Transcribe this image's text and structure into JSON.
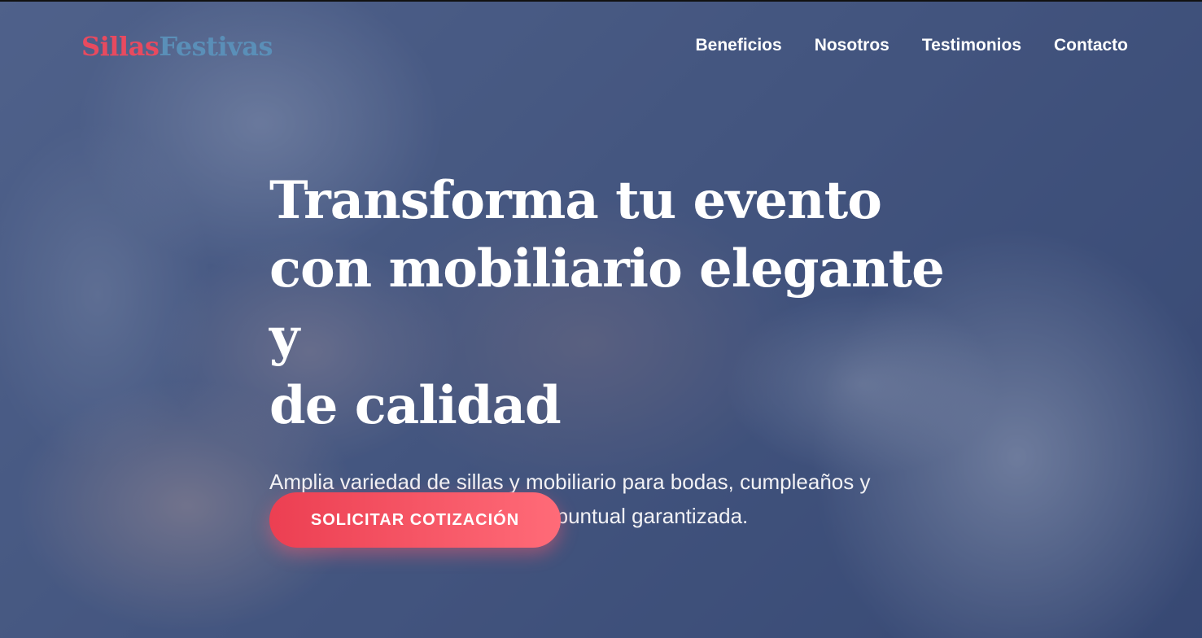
{
  "brand": {
    "part1": "Sillas",
    "part2": "Festivas",
    "colors": {
      "part1": "#e84a5f",
      "part2": "#5a8fb8"
    }
  },
  "nav": {
    "items": [
      {
        "label": "Beneficios"
      },
      {
        "label": "Nosotros"
      },
      {
        "label": "Testimonios"
      },
      {
        "label": "Contacto"
      }
    ]
  },
  "hero": {
    "headline_lines": [
      "Transforma tu evento",
      "con mobiliario elegante y",
      "de calidad"
    ],
    "subtitle": "Amplia variedad de sillas y mobiliario para bodas, cumpleaños y eventos corporativos. Entrega puntual garantizada.",
    "cta_label": "SOLICITAR COTIZACIÓN",
    "background_description_icon": "wedding-hands-photo",
    "accent_color": "#ec3f52"
  }
}
